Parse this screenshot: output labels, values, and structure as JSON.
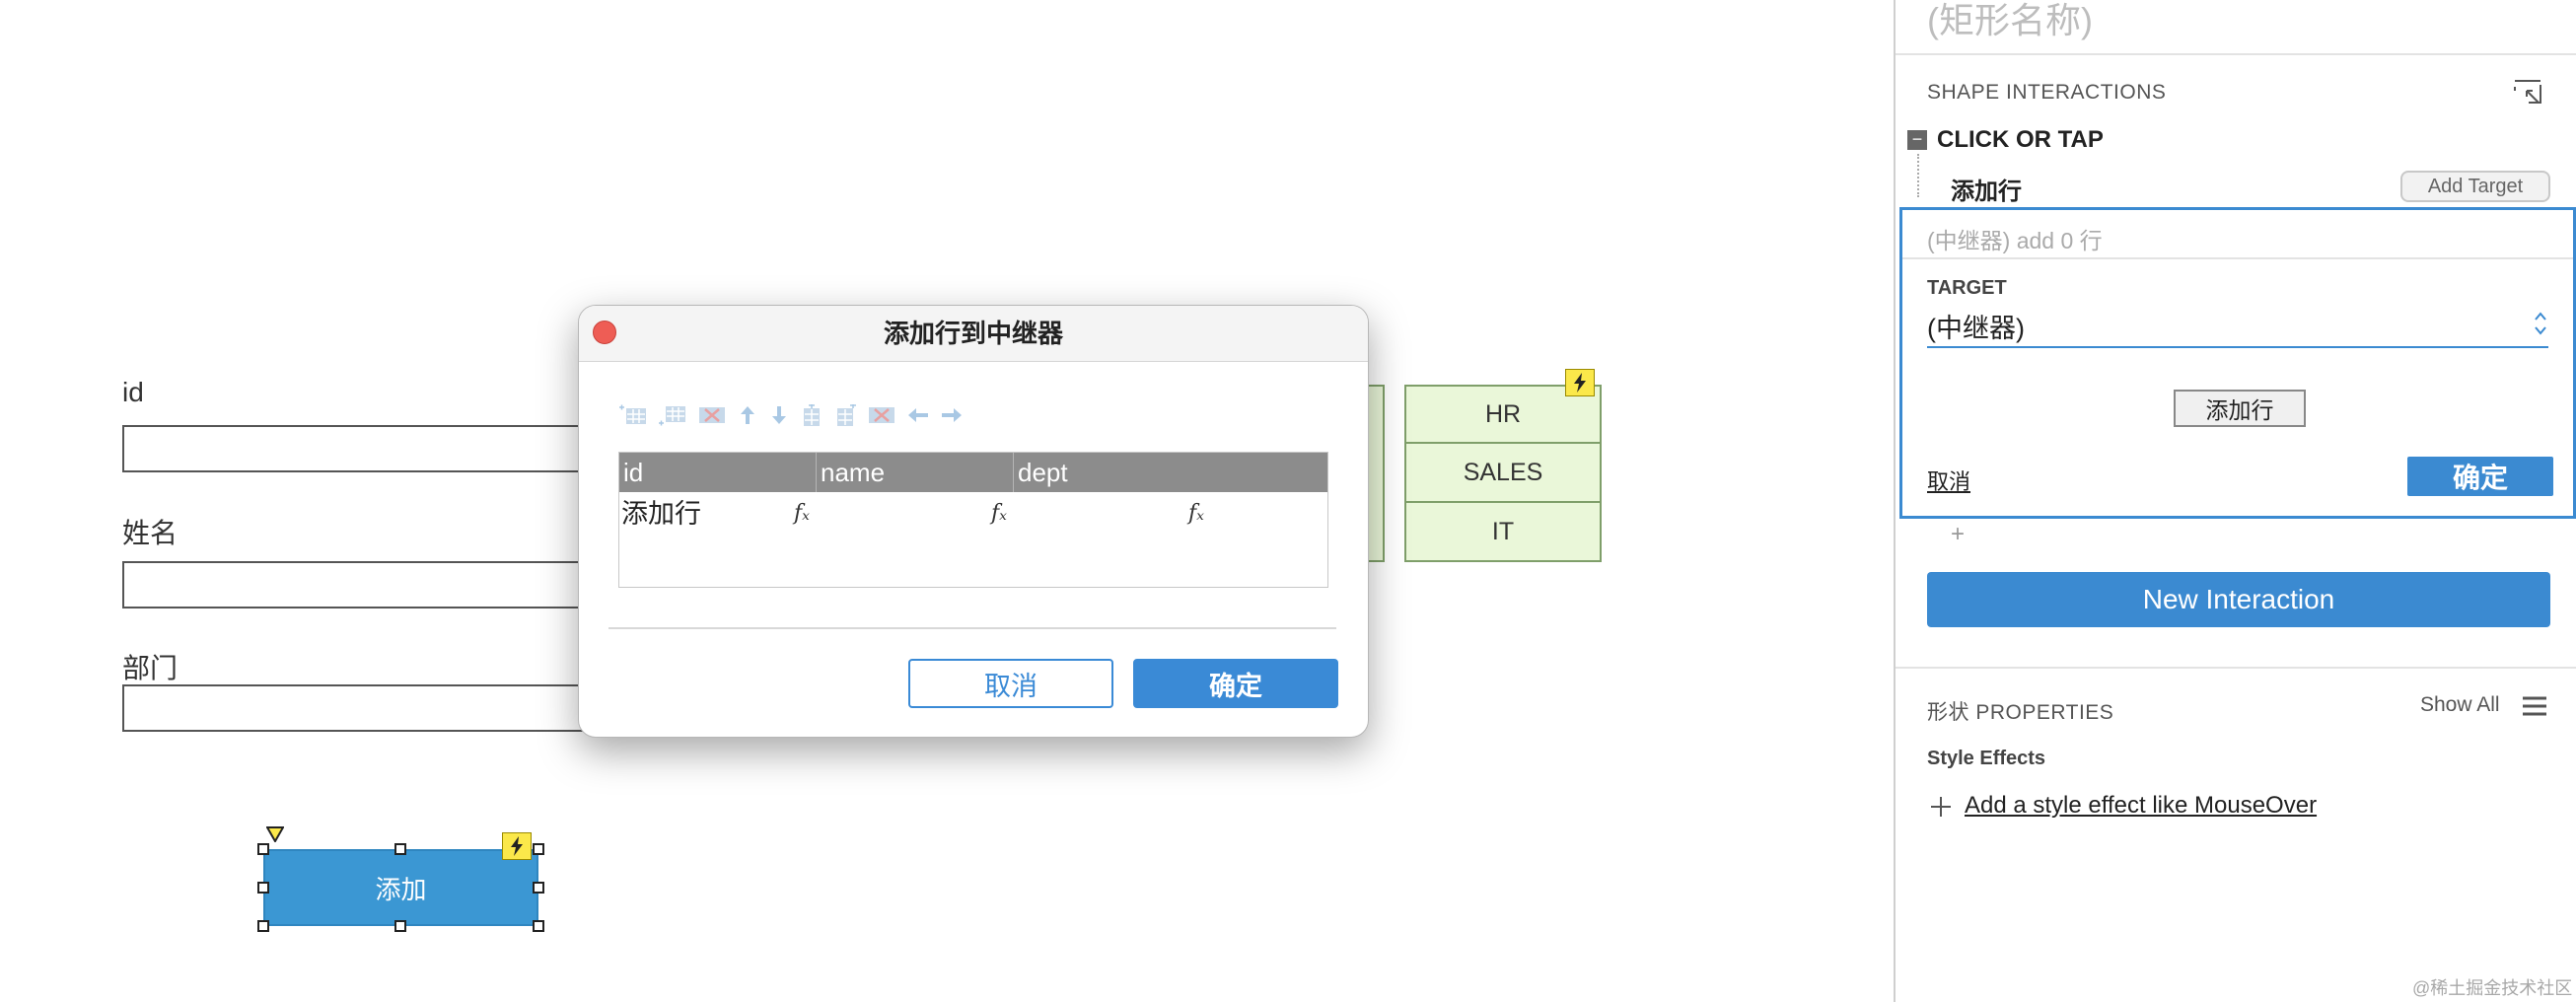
{
  "canvas": {
    "fields": [
      {
        "label": "id"
      },
      {
        "label": "姓名"
      },
      {
        "label": "部门"
      }
    ],
    "repeater": {
      "rows": [
        "HR",
        "SALES",
        "IT"
      ]
    },
    "add_button": {
      "label": "添加"
    }
  },
  "dialog": {
    "title": "添加行到中继器",
    "toolbar_icons": [
      "insert-row-above-icon",
      "insert-row-below-icon",
      "delete-row-icon",
      "move-up-icon",
      "move-down-icon",
      "insert-column-left-icon",
      "insert-column-right-icon",
      "delete-column-icon",
      "move-left-icon",
      "move-right-icon"
    ],
    "columns": [
      "id",
      "name",
      "dept"
    ],
    "rows": [
      {
        "id": "添加行",
        "name": "𝑓ₓ",
        "dept": "𝑓ₓ",
        "extra": "𝑓ₓ"
      }
    ],
    "fx_prefix": "𝑓ₓ",
    "cancel_label": "取消",
    "ok_label": "确定"
  },
  "panel": {
    "title": "(矩形名称)",
    "interactions_label": "SHAPE INTERACTIONS",
    "event_label": "CLICK OR TAP",
    "action_label": "添加行",
    "add_target_label": "Add Target",
    "summary": "(中继器) add 0 行",
    "target_label": "TARGET",
    "target_value": "(中继器)",
    "add_row_button": "添加行",
    "cancel_link": "取消",
    "ok_button": "确定",
    "plus": "+",
    "new_interaction": "New Interaction",
    "properties_label": "形状 PROPERTIES",
    "show_all": "Show All",
    "style_effects": "Style Effects",
    "add_effect_link": "Add a style effect like MouseOver",
    "watermark": "@稀土掘金技术社区"
  },
  "colors": {
    "accent": "#3b8ad1",
    "widget": "#3b97d3",
    "repeater_fill": "#eaf7d9",
    "badge": "#fbe84a",
    "close": "#ee5d55"
  }
}
